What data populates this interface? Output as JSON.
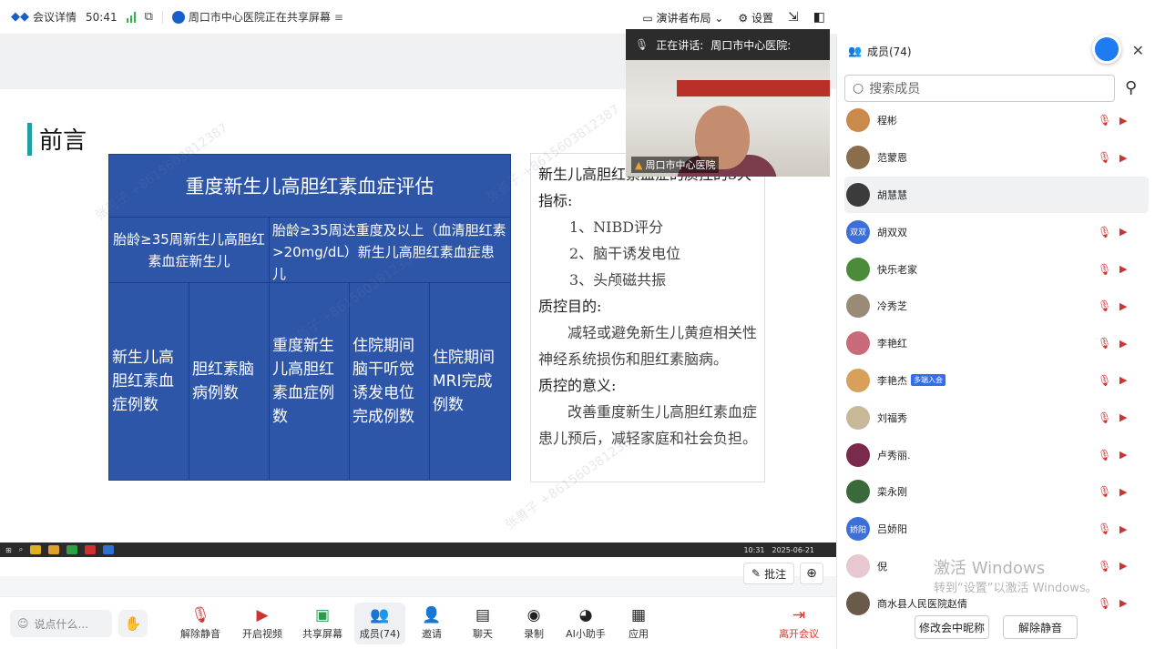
{
  "topbar": {
    "meeting_details": "会议详情",
    "timer": "50:41",
    "share_status": "周口市中心医院正在共享屏幕",
    "layout": "演讲者布局",
    "settings": "设置"
  },
  "video": {
    "speaking_label": "正在讲话:",
    "speaker": "周口市中心医院:",
    "name_tag": "周口市中心医院"
  },
  "slide": {
    "heading": "前言",
    "table": {
      "title": "重度新生儿高胆红素血症评估",
      "row2": [
        "胎龄≥35周新生儿高胆红素血症新生儿",
        "胎龄≥35周达重度及以上（血清胆红素>20mg/dL）新生儿高胆红素血症患儿"
      ],
      "row3": [
        "新生儿高胆红素血症例数",
        "胆红素脑病例数",
        "重度新生儿高胆红素血症例数",
        "住院期间脑干听觉诱发电位完成例数",
        "住院期间MRI完成例数"
      ]
    },
    "textbox": {
      "intro": "新生儿高胆红素血症的质控的3大指标:",
      "items": [
        "1、NIBD评分",
        "2、脑干诱发电位",
        "3、头颅磁共振"
      ],
      "goal_title": "质控目的:",
      "goal_text": "减轻或避免新生儿黄疸相关性神经系统损伤和胆红素脑病。",
      "meaning_title": "质控的意义:",
      "meaning_text": "改善重度新生儿高胆红素血症患儿预后，减轻家庭和社会负担。"
    },
    "taskbar_time": "10:31",
    "taskbar_date": "2025-06-21",
    "watermark": "张善子 +8615603812387"
  },
  "annotate": {
    "label": "批注"
  },
  "toolbar": {
    "say_placeholder": "说点什么...",
    "items": [
      "解除静音",
      "开启视频",
      "共享屏幕",
      "成员(74)",
      "邀请",
      "聊天",
      "录制",
      "AI小助手",
      "应用",
      "离开会议"
    ]
  },
  "panel": {
    "title": "成员(74)",
    "search_placeholder": "搜索成员",
    "members": [
      {
        "name": "程彬",
        "color": "#c98a4b",
        "label": ""
      },
      {
        "name": "范蒙恩",
        "color": "#8a6e4c",
        "label": ""
      },
      {
        "name": "胡慧慧",
        "color": "#3b3b3b",
        "label": ""
      },
      {
        "name": "胡双双",
        "color": "#3c6fd8",
        "label": "双双"
      },
      {
        "name": "快乐老家",
        "color": "#4a8c3a",
        "label": ""
      },
      {
        "name": "冷秀芝",
        "color": "#9a8a78",
        "label": ""
      },
      {
        "name": "李艳红",
        "color": "#c86a7a",
        "label": ""
      },
      {
        "name": "李艳杰",
        "color": "#d8a05a",
        "label": "",
        "badge": "多端入会"
      },
      {
        "name": "刘福秀",
        "color": "#c8b898",
        "label": ""
      },
      {
        "name": "卢秀丽.",
        "color": "#7a2a4a",
        "label": ""
      },
      {
        "name": "栾永刚",
        "color": "#3a6a3a",
        "label": ""
      },
      {
        "name": "吕娇阳",
        "color": "#3c6fd8",
        "label": "娇阳"
      },
      {
        "name": "倪",
        "color": "#e8c8d0",
        "label": ""
      },
      {
        "name": "商水县人民医院赵倩",
        "color": "#6a5a4a",
        "label": ""
      }
    ],
    "activate_1": "激活 Windows",
    "activate_2": "转到“设置”以激活 Windows。",
    "btn_rename": "修改会中昵称",
    "btn_unmute": "解除静音"
  }
}
